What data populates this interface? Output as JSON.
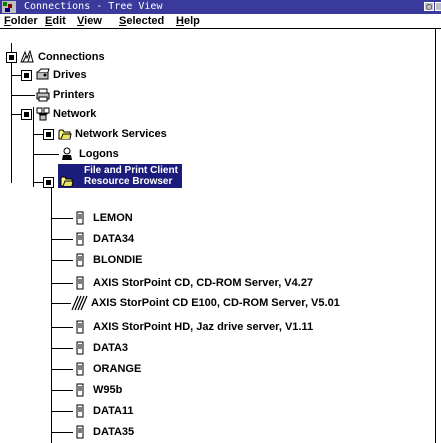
{
  "window": {
    "title": "Connections - Tree View"
  },
  "menu": [
    "Folder",
    "Edit",
    "View",
    "Selected",
    "Help"
  ],
  "tree": {
    "root": "Connections",
    "drives": "Drives",
    "printers": "Printers",
    "network": "Network",
    "network_services": "Network Services",
    "logons": "Logons",
    "selected_line1": "File and Print Client",
    "selected_line2": "Resource Browser",
    "resources": [
      "LEMON",
      "DATA34",
      "BLONDIE",
      "AXIS StorPoint CD, CD-ROM Server, V4.27",
      "AXIS StorPoint CD E100, CD-ROM Server, V5.01",
      "AXIS StorPoint HD, Jaz drive server, V1.11",
      "DATA3",
      "ORANGE",
      "W95b",
      "DATA11",
      "DATA35"
    ]
  }
}
